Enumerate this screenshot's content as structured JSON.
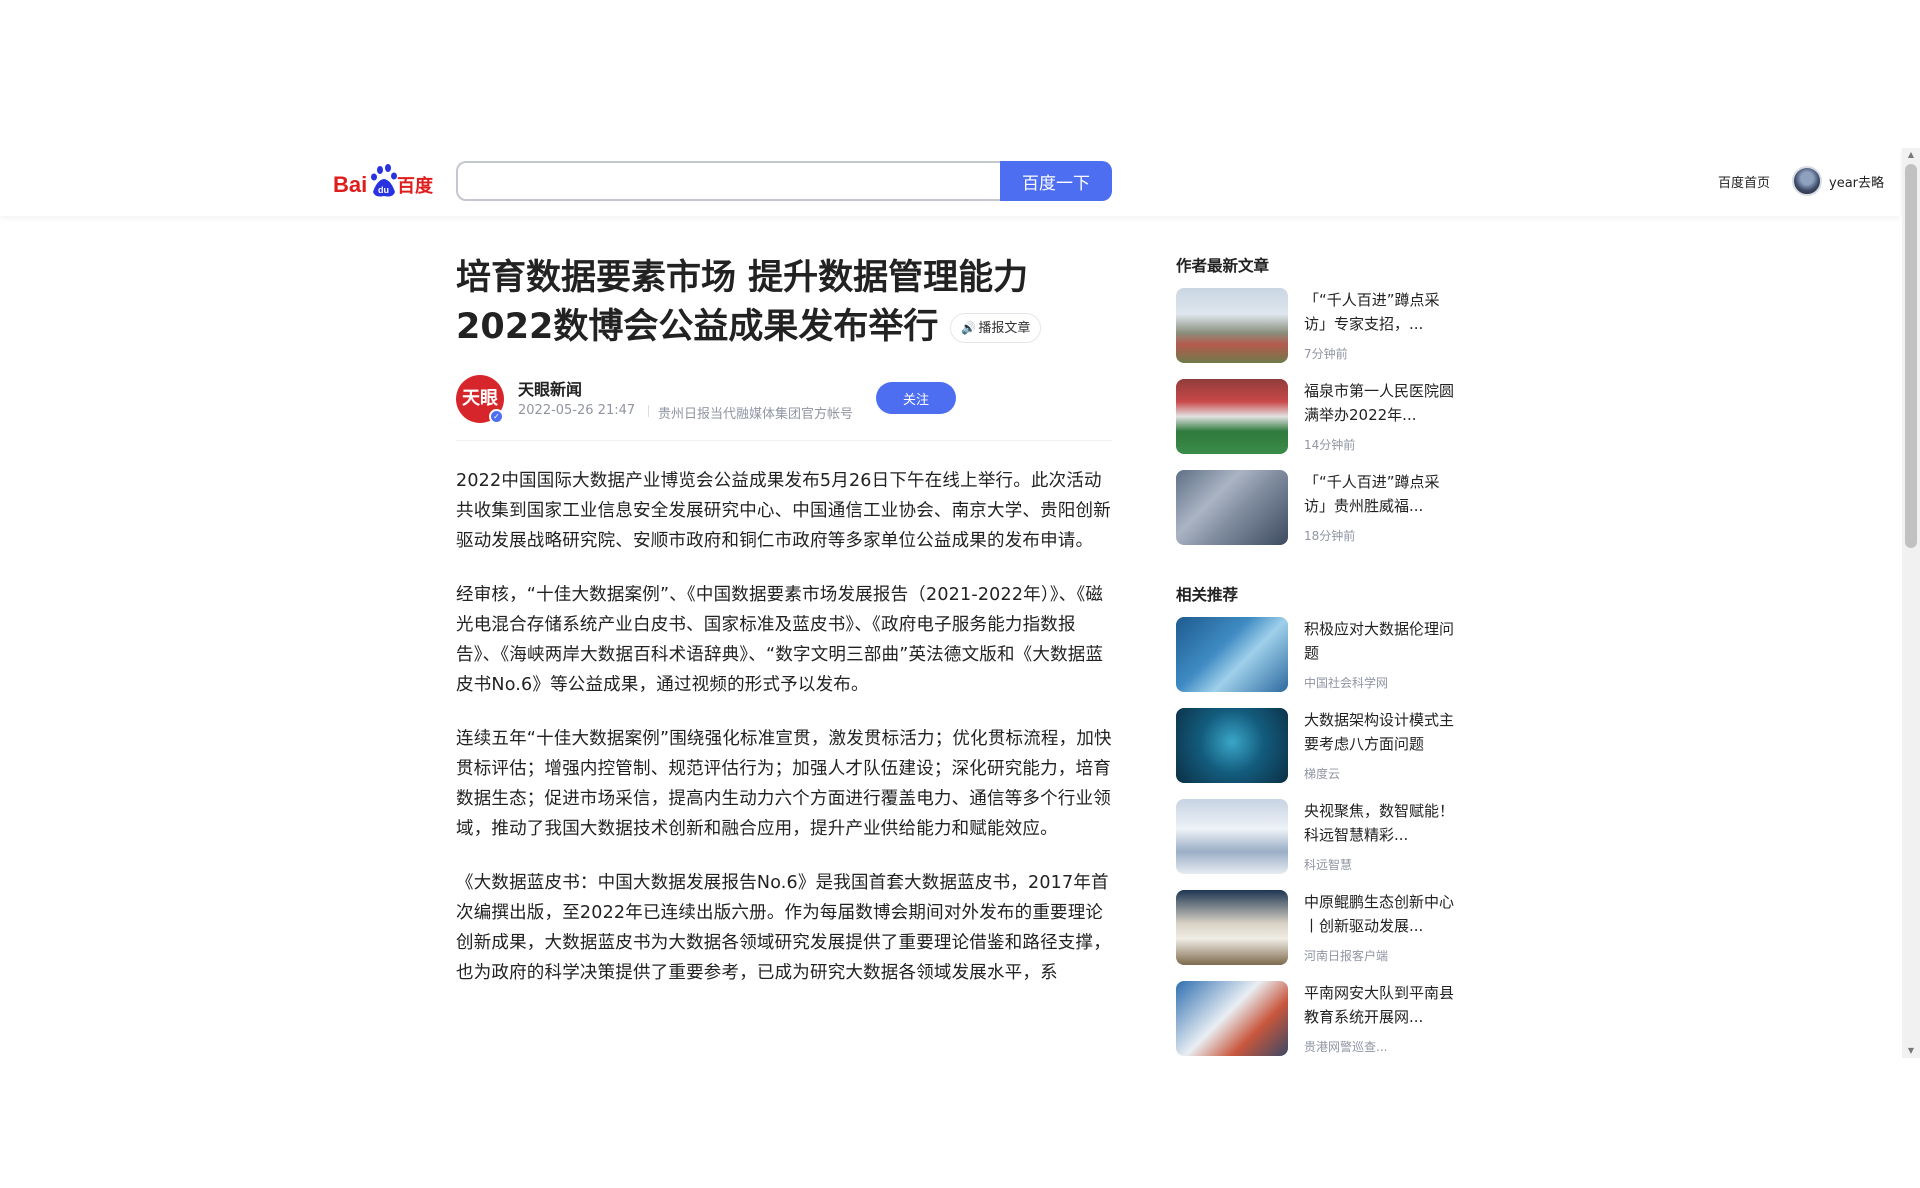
{
  "header": {
    "logo_text": "Bai百度",
    "search_placeholder": "",
    "search_button": "百度一下",
    "home_link": "百度首页",
    "username": "year去略"
  },
  "article": {
    "title_line1": "培育数据要素市场 提升数据管理能力",
    "title_line2": "2022数博会公益成果发布举行",
    "speak_label": "播报文章",
    "author_name": "天眼新闻",
    "author_avatar_text": "天眼",
    "pub_time": "2022-05-26 21:47",
    "source_tag": "贵州日报当代融媒体集团官方帐号",
    "follow_label": "关注",
    "paragraphs": [
      "2022中国国际大数据产业博览会公益成果发布5月26日下午在线上举行。此次活动共收集到国家工业信息安全发展研究中心、中国通信工业协会、南京大学、贵阳创新驱动发展战略研究院、安顺市政府和铜仁市政府等多家单位公益成果的发布申请。",
      "经审核，“十佳大数据案例”、《中国数据要素市场发展报告（2021-2022年）》、《磁光电混合存储系统产业白皮书、国家标准及蓝皮书》、《政府电子服务能力指数报告》、《海峡两岸大数据百科术语辞典》、“数字文明三部曲”英法德文版和《大数据蓝皮书No.6》等公益成果，通过视频的形式予以发布。",
      "连续五年“十佳大数据案例”围绕强化标准宣贯，激发贯标活力；优化贯标流程，加快贯标评估；增强内控管制、规范评估行为；加强人才队伍建设；深化研究能力，培育数据生态；促进市场采信，提高内生动力六个方面进行覆盖电力、通信等多个行业领域，推动了我国大数据技术创新和融合应用，提升产业供给能力和赋能效应。",
      "《大数据蓝皮书：中国大数据发展报告No.6》是我国首套大数据蓝皮书，2017年首次编撰出版，至2022年已连续出版六册。作为每届数博会期间对外发布的重要理论创新成果，大数据蓝皮书为大数据各领域研究发展提供了重要理论借鉴和路径支撑，也为政府的科学决策提供了重要参考，已成为研究大数据各领域发展水平，系"
    ]
  },
  "sidebar": {
    "latest_heading": "作者最新文章",
    "latest": [
      {
        "title": "「“千人百进”蹲点采访」专家支招，...",
        "meta": "7分钟前"
      },
      {
        "title": "福泉市第一人民医院圆满举办2022年...",
        "meta": "14分钟前"
      },
      {
        "title": "「“千人百进”蹲点采访」贵州胜威福...",
        "meta": "18分钟前"
      }
    ],
    "related_heading": "相关推荐",
    "related": [
      {
        "title": "积极应对大数据伦理问题",
        "meta": "中国社会科学网"
      },
      {
        "title": "大数据架构设计模式主要考虑八方面问题",
        "meta": "梯度云"
      },
      {
        "title": "央视聚焦，数智赋能！科远智慧精彩...",
        "meta": "科远智慧"
      },
      {
        "title": "中原鲲鹏生态创新中心丨创新驱动发展...",
        "meta": "河南日报客户端"
      },
      {
        "title": "平南网安大队到平南县教育系统开展网...",
        "meta": "贵港网警巡查..."
      }
    ]
  }
}
